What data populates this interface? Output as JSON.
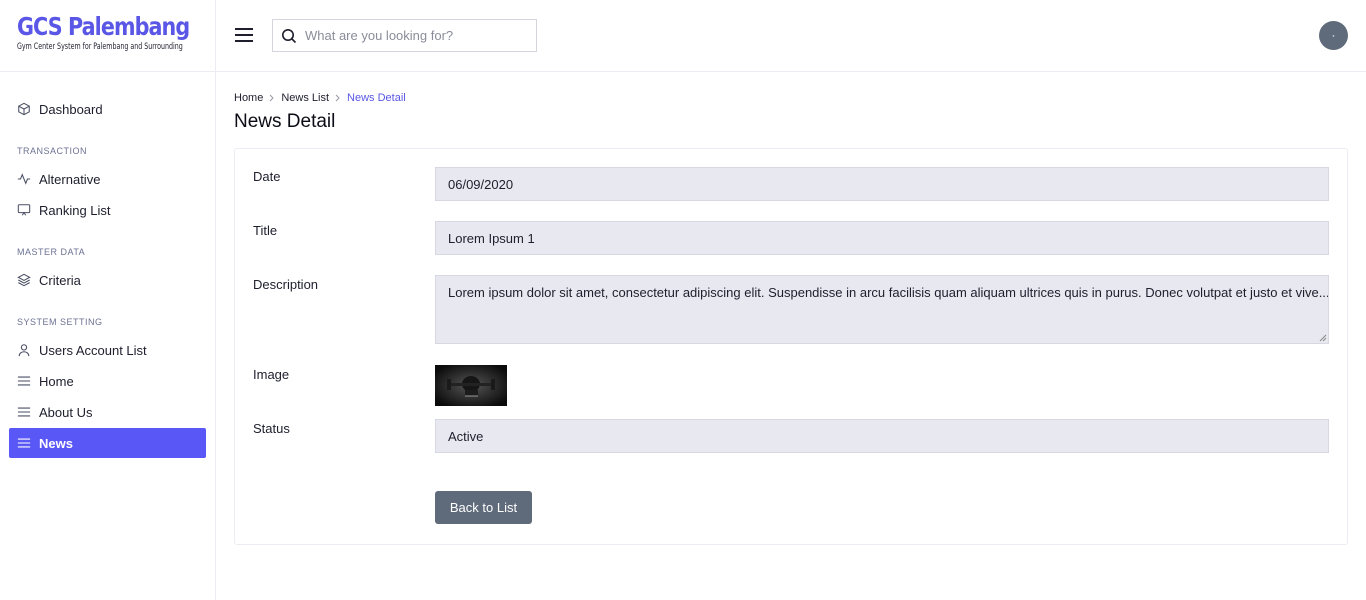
{
  "brand": {
    "title": "GCS Palembang",
    "subtitle": "Gym Center System for Palembang and Surrounding"
  },
  "sidebar": {
    "items": [
      {
        "label": "Dashboard",
        "icon": "cube-icon"
      }
    ],
    "sections": [
      {
        "title": "TRANSACTION",
        "items": [
          {
            "label": "Alternative",
            "icon": "activity-icon"
          },
          {
            "label": "Ranking List",
            "icon": "monitor-icon"
          }
        ]
      },
      {
        "title": "MASTER DATA",
        "items": [
          {
            "label": "Criteria",
            "icon": "layers-icon"
          }
        ]
      },
      {
        "title": "SYSTEM SETTING",
        "items": [
          {
            "label": "Users Account List",
            "icon": "user-icon"
          },
          {
            "label": "Home",
            "icon": "menu-icon"
          },
          {
            "label": "About Us",
            "icon": "menu-icon"
          },
          {
            "label": "News",
            "icon": "menu-icon",
            "active": true
          }
        ]
      }
    ]
  },
  "topbar": {
    "search_placeholder": "What are you looking for?",
    "avatar_icon": "avatar-icon"
  },
  "breadcrumb": [
    "Home",
    "News List",
    "News Detail"
  ],
  "page_title": "News Detail",
  "form": {
    "date_label": "Date",
    "date_value": "06/09/2020",
    "title_label": "Title",
    "title_value": "Lorem Ipsum 1",
    "description_label": "Description",
    "description_value": "Lorem ipsum dolor sit amet, consectetur adipiscing elit. Suspendisse in arcu facilisis quam aliquam ultrices quis in purus. Donec volutpat et justo et vive...",
    "image_label": "Image",
    "status_label": "Status",
    "status_value": "Active",
    "back_button": "Back to List"
  },
  "colors": {
    "accent": "#5a57f7",
    "field_bg": "#e8e8f0",
    "button_bg": "#5f6b7a"
  }
}
